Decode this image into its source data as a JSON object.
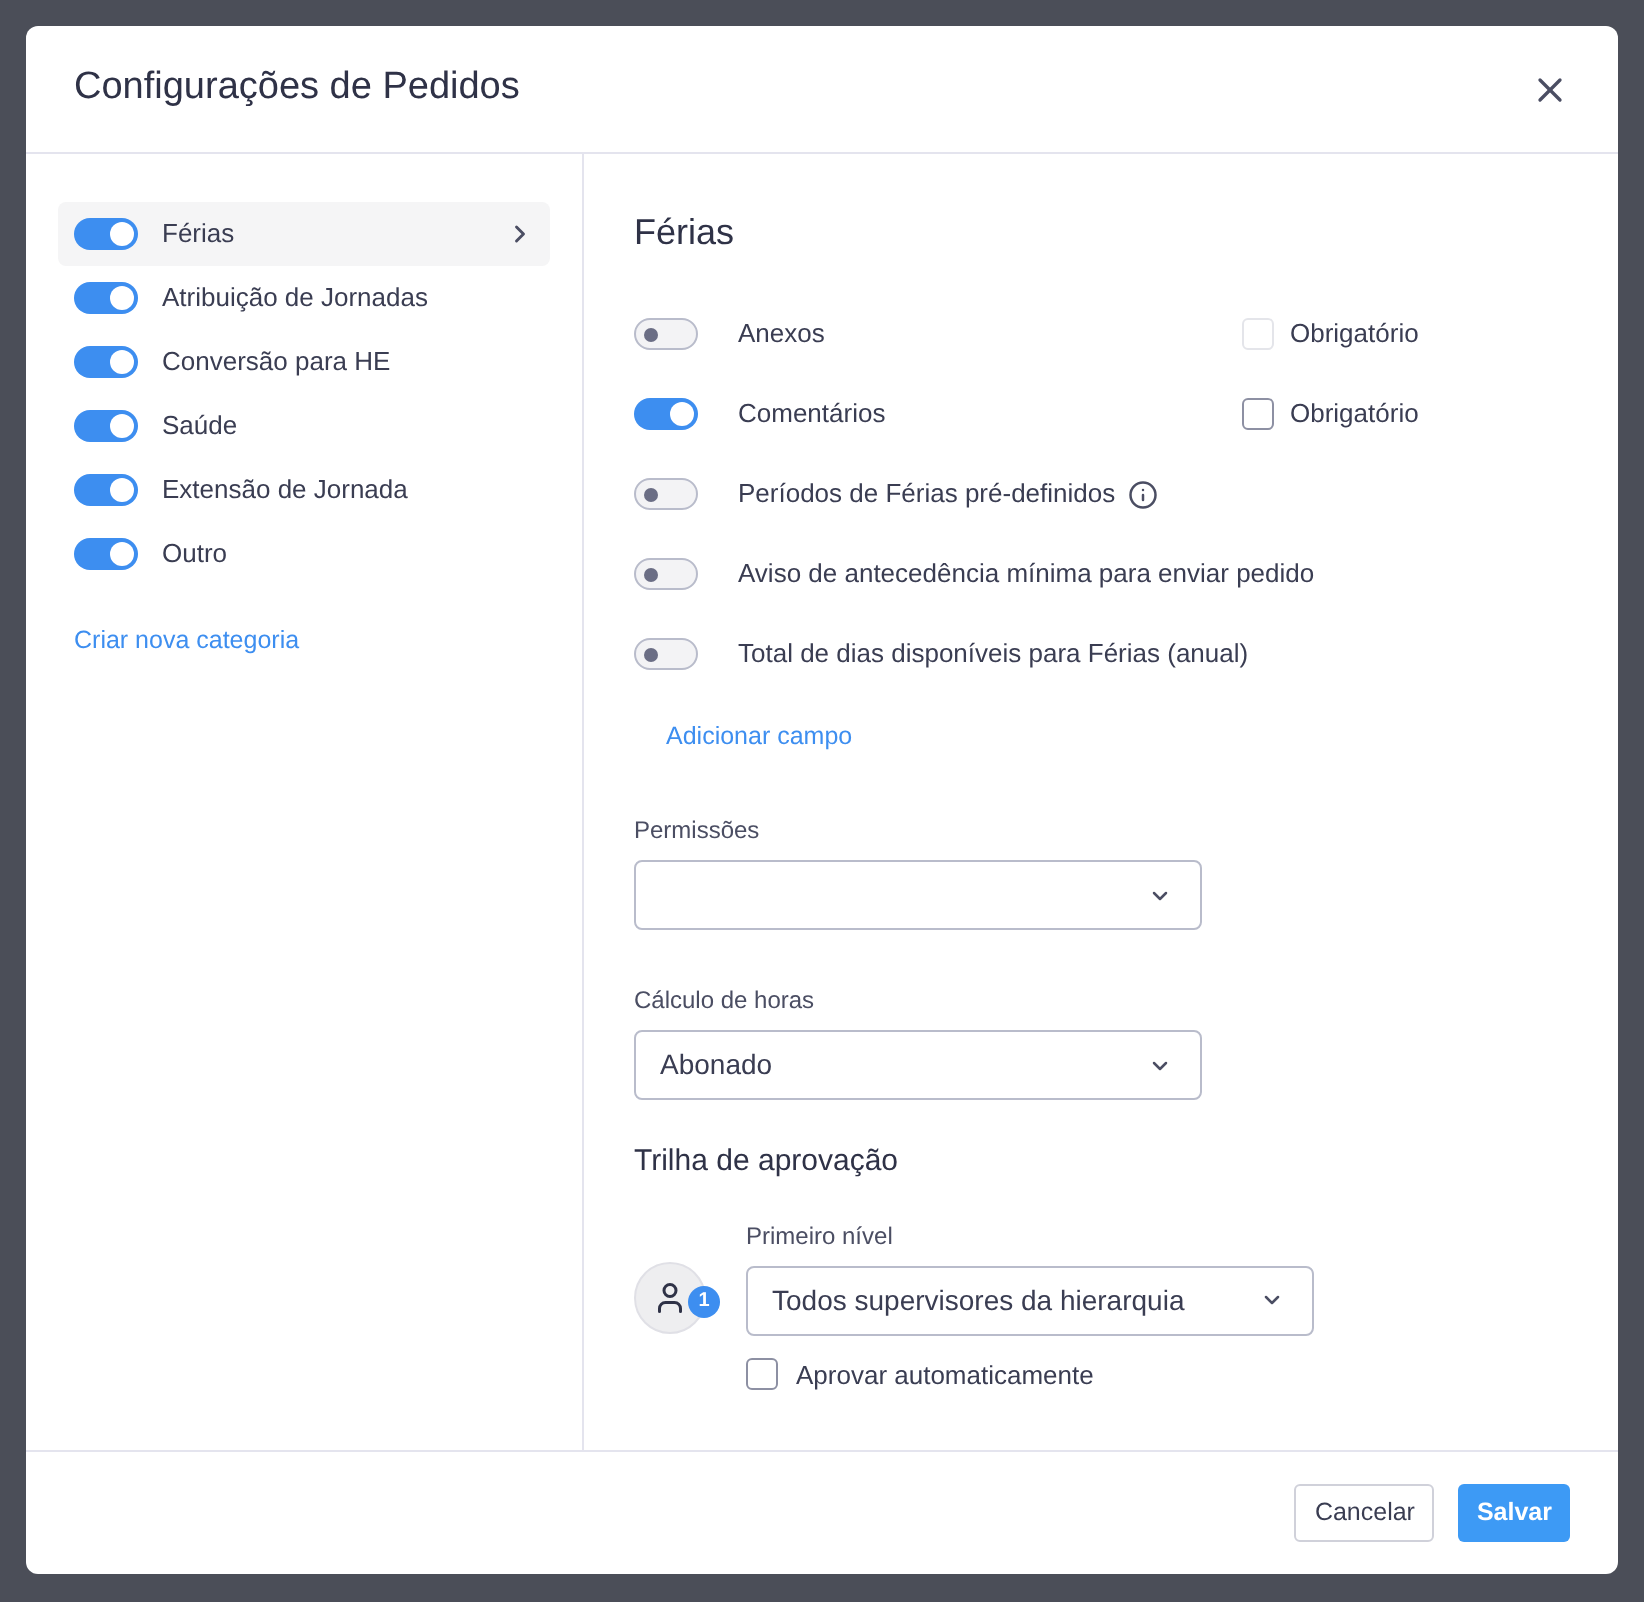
{
  "dialog": {
    "title": "Configurações de Pedidos"
  },
  "sidebar": {
    "items": [
      {
        "label": "Férias",
        "on": true,
        "selected": true
      },
      {
        "label": "Atribuição de Jornadas",
        "on": true,
        "selected": false
      },
      {
        "label": "Conversão para HE",
        "on": true,
        "selected": false
      },
      {
        "label": "Saúde",
        "on": true,
        "selected": false
      },
      {
        "label": "Extensão de Jornada",
        "on": true,
        "selected": false
      },
      {
        "label": "Outro",
        "on": true,
        "selected": false
      }
    ],
    "link": "Criar nova categoria"
  },
  "content": {
    "title": "Férias",
    "fields": [
      {
        "label": "Anexos",
        "on": false,
        "info": false,
        "required": {
          "label": "Obrigatório",
          "checked": false,
          "disabled": true
        }
      },
      {
        "label": "Comentários",
        "on": true,
        "info": false,
        "required": {
          "label": "Obrigatório",
          "checked": false,
          "disabled": false
        }
      },
      {
        "label": "Períodos de Férias pré-definidos",
        "on": false,
        "info": true
      },
      {
        "label": "Aviso de antecedência mínima para enviar pedido",
        "on": false,
        "info": false
      },
      {
        "label": "Total de dias disponíveis para Férias (anual)",
        "on": false,
        "info": false
      }
    ],
    "add_field": "Adicionar campo",
    "selects": [
      {
        "label": "Permissões"
      },
      {
        "label": "Cálculo de horas",
        "value": "Abonado"
      }
    ],
    "approval": {
      "title": "Trilha de aprovação",
      "levels": [
        {
          "badge": "1",
          "label": "Primeiro nível",
          "value": "Todos supervisores da hierarquia",
          "auto": {
            "label": "Aprovar automaticamente",
            "checked": false
          }
        }
      ]
    }
  },
  "footer": {
    "buttons": [
      {
        "label": "Cancelar",
        "kind": "secondary"
      },
      {
        "label": "Salvar",
        "kind": "primary"
      }
    ]
  }
}
